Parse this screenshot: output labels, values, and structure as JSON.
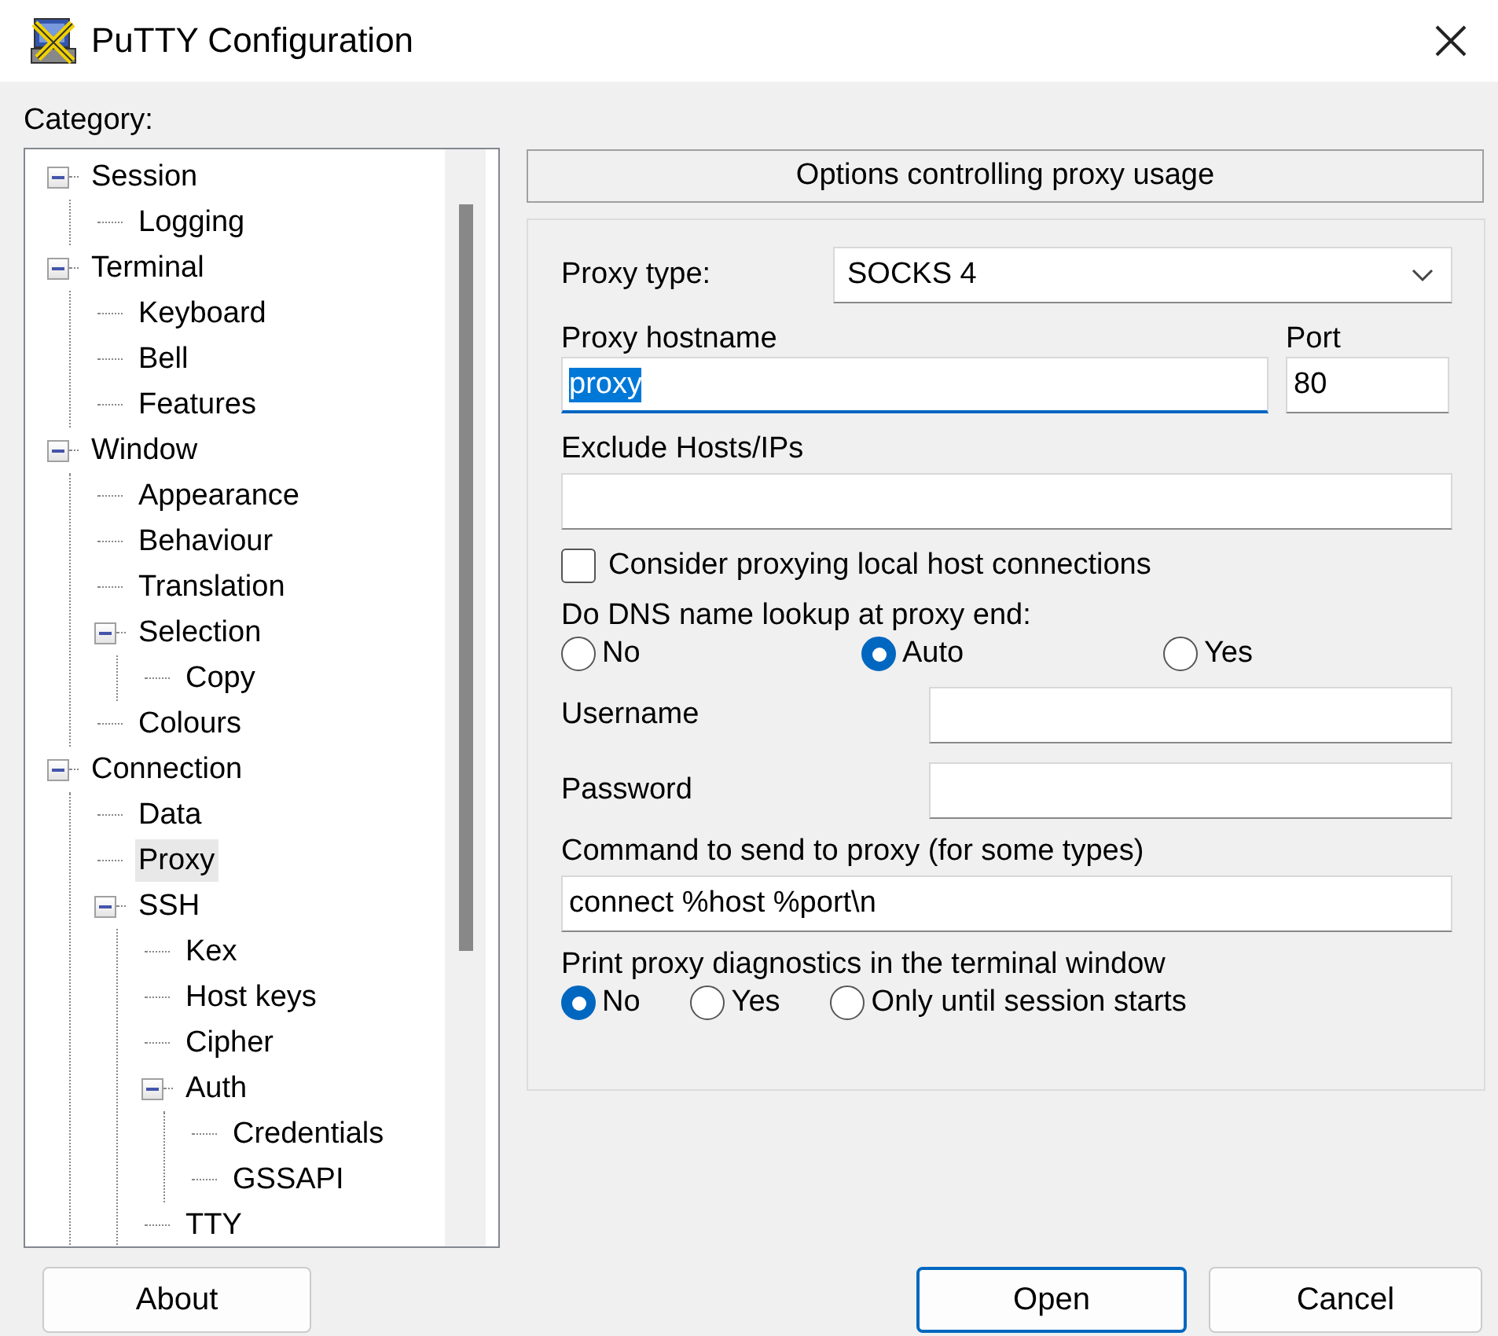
{
  "window": {
    "title": "PuTTY Configuration"
  },
  "category_label": "Category:",
  "tree": [
    {
      "label": "Session",
      "expanded": true,
      "selected": false,
      "children": [
        {
          "label": "Logging",
          "selected": false
        }
      ]
    },
    {
      "label": "Terminal",
      "expanded": true,
      "selected": false,
      "children": [
        {
          "label": "Keyboard",
          "selected": false
        },
        {
          "label": "Bell",
          "selected": false
        },
        {
          "label": "Features",
          "selected": false
        }
      ]
    },
    {
      "label": "Window",
      "expanded": true,
      "selected": false,
      "children": [
        {
          "label": "Appearance",
          "selected": false
        },
        {
          "label": "Behaviour",
          "selected": false
        },
        {
          "label": "Translation",
          "selected": false
        },
        {
          "label": "Selection",
          "expanded": true,
          "selected": false,
          "children": [
            {
              "label": "Copy",
              "selected": false
            }
          ]
        },
        {
          "label": "Colours",
          "selected": false
        }
      ]
    },
    {
      "label": "Connection",
      "expanded": true,
      "selected": false,
      "children": [
        {
          "label": "Data",
          "selected": false
        },
        {
          "label": "Proxy",
          "selected": true
        },
        {
          "label": "SSH",
          "expanded": true,
          "selected": false,
          "children": [
            {
              "label": "Kex",
              "selected": false
            },
            {
              "label": "Host keys",
              "selected": false
            },
            {
              "label": "Cipher",
              "selected": false
            },
            {
              "label": "Auth",
              "expanded": true,
              "selected": false,
              "children": [
                {
                  "label": "Credentials",
                  "selected": false
                },
                {
                  "label": "GSSAPI",
                  "selected": false
                }
              ]
            },
            {
              "label": "TTY",
              "selected": false
            }
          ]
        }
      ]
    }
  ],
  "panel": {
    "heading": "Options controlling proxy usage",
    "proxy_type": {
      "label": "Proxy type:",
      "value": "SOCKS 4"
    },
    "hostname": {
      "label": "Proxy hostname",
      "value": "proxy",
      "text_selected": true,
      "focused": true
    },
    "port": {
      "label": "Port",
      "value": "80"
    },
    "exclude": {
      "label": "Exclude Hosts/IPs"
    },
    "local_checkbox": {
      "label": "Consider proxying local host connections",
      "checked": false
    },
    "dns": {
      "label": "Do DNS name lookup at proxy end:",
      "options": [
        {
          "label": "No",
          "selected": false
        },
        {
          "label": "Auto",
          "selected": true
        },
        {
          "label": "Yes",
          "selected": false
        }
      ]
    },
    "username": {
      "label": "Username"
    },
    "password": {
      "label": "Password"
    },
    "command": {
      "label": "Command to send to proxy (for some types)",
      "value": "connect %host %port\\n"
    },
    "diagnostics": {
      "label": "Print proxy diagnostics in the terminal window",
      "options": [
        {
          "label": "No",
          "selected": true
        },
        {
          "label": "Yes",
          "selected": false
        },
        {
          "label": "Only until session starts",
          "selected": false
        }
      ]
    }
  },
  "buttons": [
    {
      "label": "About",
      "focused": false
    },
    {
      "label": "Open",
      "focused": true
    },
    {
      "label": "Cancel",
      "focused": false
    }
  ]
}
